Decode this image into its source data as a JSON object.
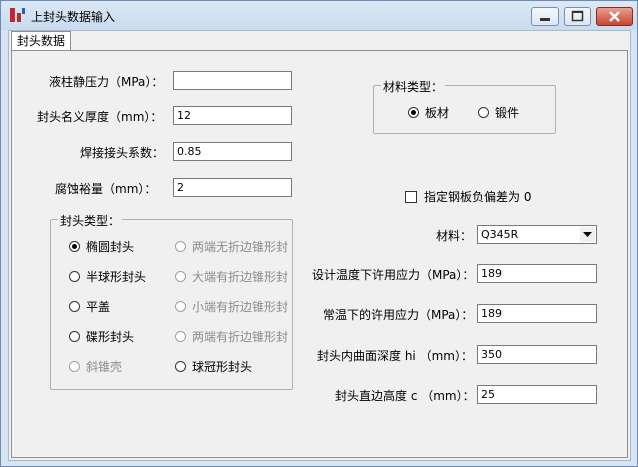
{
  "window": {
    "title": "上封头数据输入"
  },
  "tab": {
    "label": "封头数据"
  },
  "fields": {
    "hydro_pressure": {
      "label": "液柱静压力（MPa）：",
      "value": ""
    },
    "nominal_thickness": {
      "label": "封头名义厚度（mm）：",
      "value": "12"
    },
    "weld_coeff": {
      "label": "焊接接头系数：",
      "value": "0.85"
    },
    "corrosion": {
      "label": "腐蚀裕量（mm）：",
      "value": "2"
    }
  },
  "head_type": {
    "title": "封头类型：",
    "options": [
      {
        "label": "椭圆封头",
        "selected": true,
        "enabled": true
      },
      {
        "label": "两端无折边锥形封",
        "selected": false,
        "enabled": false
      },
      {
        "label": "半球形封头",
        "selected": false,
        "enabled": true
      },
      {
        "label": "大端有折边锥形封",
        "selected": false,
        "enabled": false
      },
      {
        "label": "平盖",
        "selected": false,
        "enabled": true
      },
      {
        "label": "小端有折边锥形封",
        "selected": false,
        "enabled": false
      },
      {
        "label": "碟形封头",
        "selected": false,
        "enabled": true
      },
      {
        "label": "两端有折边锥形封",
        "selected": false,
        "enabled": false
      },
      {
        "label": "斜锥壳",
        "selected": false,
        "enabled": false
      },
      {
        "label": "球冠形封头",
        "selected": false,
        "enabled": true
      }
    ]
  },
  "material_type": {
    "title": "材料类型：",
    "options": [
      {
        "label": "板材",
        "selected": true
      },
      {
        "label": "锻件",
        "selected": false
      }
    ]
  },
  "zero_tolerance": {
    "label": "指定钢板负偏差为 0",
    "checked": false
  },
  "material": {
    "label": "材料：",
    "value": "Q345R"
  },
  "right_fields": {
    "design_temp_stress": {
      "label": "设计温度下许用应力（MPa）：",
      "value": "189"
    },
    "room_temp_stress": {
      "label": "常温下的许用应力（MPa）：",
      "value": "189"
    },
    "inner_depth": {
      "label": "封头内曲面深度 hi （mm）：",
      "value": "350"
    },
    "straight_height": {
      "label": "封头直边高度 c （mm）：",
      "value": "25"
    }
  },
  "colors": {
    "titlebar": "#c9dbee",
    "close_button": "#c8452f",
    "panel": "#f0f0f0",
    "disabled_text": "#8c8c8c"
  }
}
